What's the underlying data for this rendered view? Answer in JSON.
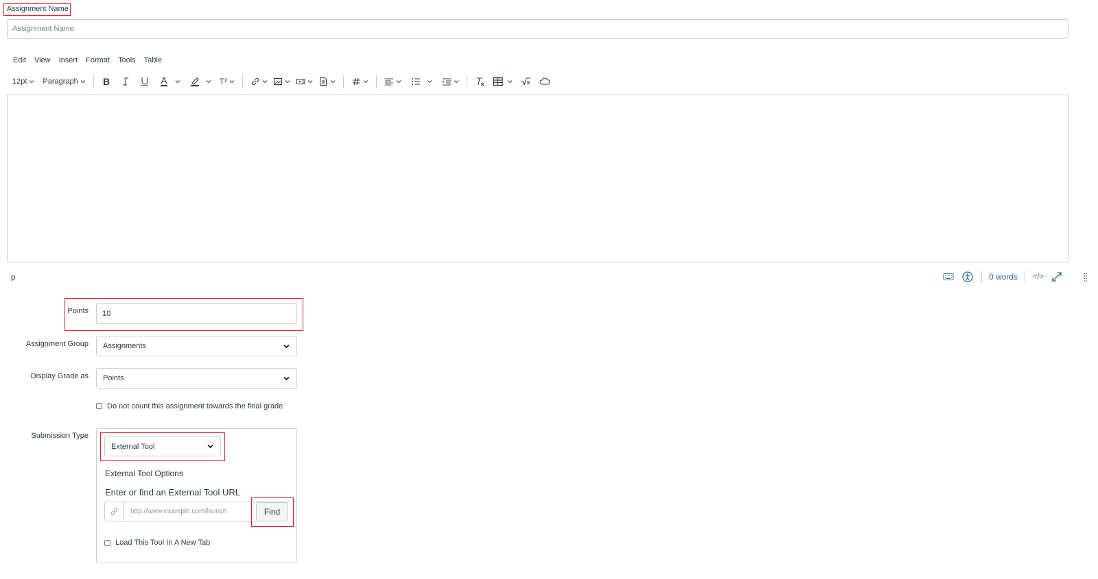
{
  "assignment_name": {
    "label": "Assignment Name",
    "placeholder": "Assignment Name",
    "value": ""
  },
  "editor": {
    "menubar": [
      "Edit",
      "View",
      "Insert",
      "Format",
      "Tools",
      "Table"
    ],
    "toolbar": {
      "font_size": "12pt",
      "block_format": "Paragraph",
      "superscript_label": "T²"
    },
    "status": {
      "path": "p",
      "word_count": "0 words",
      "html_toggle": "</>"
    }
  },
  "points": {
    "label": "Points",
    "value": "10"
  },
  "assignment_group": {
    "label": "Assignment Group",
    "selected": "Assignments"
  },
  "display_grade": {
    "label": "Display Grade as",
    "selected": "Points"
  },
  "omit_final_grade": {
    "label": "Do not count this assignment towards the final grade",
    "checked": false
  },
  "submission_type": {
    "label": "Submission Type",
    "selected": "External Tool",
    "options_title": "External Tool Options",
    "url_title": "Enter or find an External Tool URL",
    "url_placeholder": "http://www.example.com/launch",
    "find_label": "Find",
    "new_tab_label": "Load This Tool In A New Tab",
    "new_tab_checked": false
  },
  "colors": {
    "highlight_box": "#e0202a",
    "text": "#2d3b45",
    "link": "#2d6c9e",
    "border": "#c7cdd1"
  }
}
